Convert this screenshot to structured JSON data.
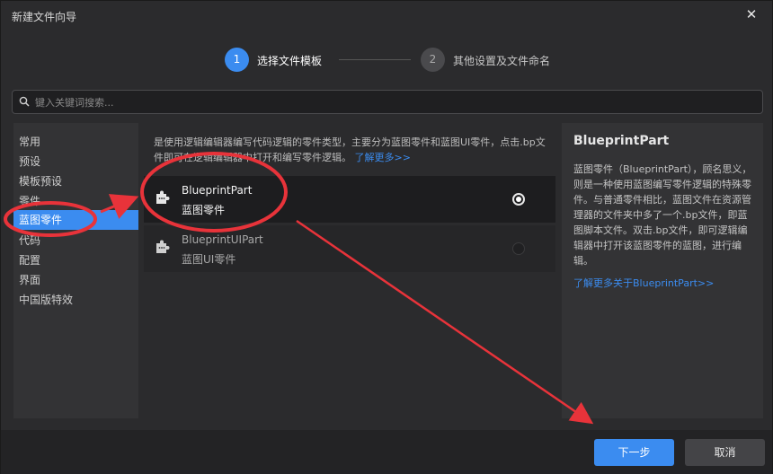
{
  "window": {
    "title": "新建文件向导",
    "close_icon": "close-icon"
  },
  "steps": [
    {
      "num": "1",
      "label": "选择文件模板",
      "active": true
    },
    {
      "num": "2",
      "label": "其他设置及文件命名",
      "active": false
    }
  ],
  "search": {
    "placeholder": "键入关键词搜索...",
    "value": ""
  },
  "sidebar": {
    "items": [
      {
        "label": "常用"
      },
      {
        "label": "预设"
      },
      {
        "label": "模板预设"
      },
      {
        "label": "零件"
      },
      {
        "label": "蓝图零件",
        "active": true
      },
      {
        "label": "代码"
      },
      {
        "label": "配置"
      },
      {
        "label": "界面"
      },
      {
        "label": "中国版特效"
      }
    ]
  },
  "center": {
    "description": "是使用逻辑编辑器编写代码逻辑的零件类型，主要分为蓝图零件和蓝图UI零件，点击.bp文件即可在逻辑编辑器中打开和编写零件逻辑。",
    "description_link": "了解更多>>",
    "items": [
      {
        "name": "BlueprintPart",
        "subtitle": "蓝图零件",
        "icon": "puzzle-piece-icon",
        "selected": true
      },
      {
        "name": "BlueprintUIPart",
        "subtitle": "蓝图UI零件",
        "icon": "puzzle-piece-icon",
        "selected": false
      }
    ]
  },
  "detail": {
    "title": "BlueprintPart",
    "description": "蓝图零件（BlueprintPart），顾名思义，则是一种使用蓝图编写零件逻辑的特殊零件。与普通零件相比，蓝图文件在资源管理器的文件夹中多了一个.bp文件，即蓝图脚本文件。双击.bp文件，即可逻辑编辑器中打开该蓝图零件的蓝图，进行编辑。",
    "link": "了解更多关于BlueprintPart>>"
  },
  "footer": {
    "next_label": "下一步",
    "cancel_label": "取消"
  },
  "colors": {
    "accent": "#3b8cf0",
    "annotation": "#e8333a",
    "background": "#2b2b2d"
  }
}
